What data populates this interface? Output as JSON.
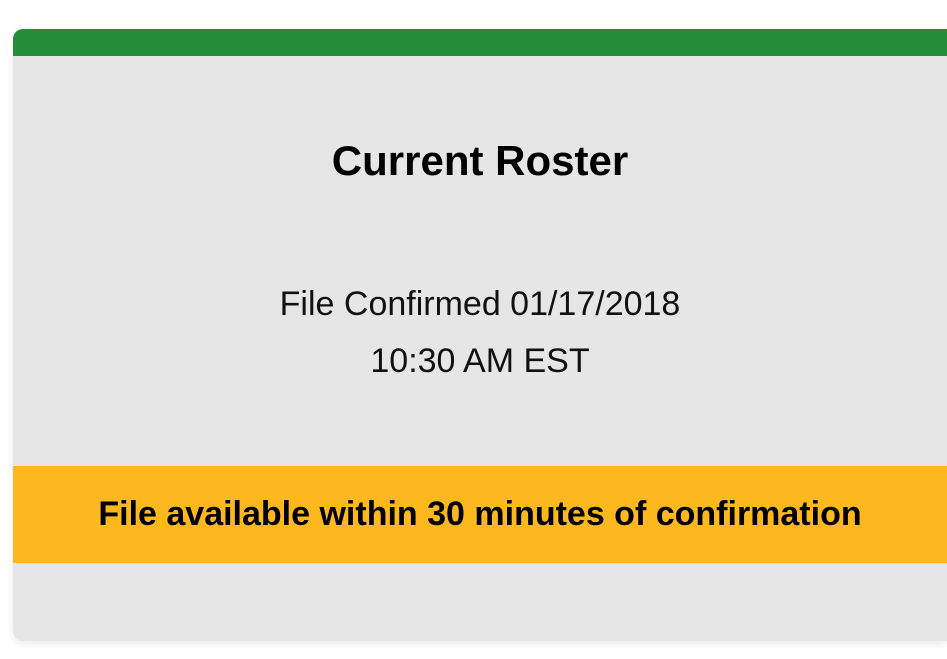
{
  "card": {
    "title": "Current Roster",
    "confirmation": {
      "line1": "File Confirmed 01/17/2018",
      "line2": "10:30 AM EST"
    },
    "notice": "File available within 30 minutes of confirmation"
  },
  "colors": {
    "status_bar": "#238e37",
    "notice_background": "#fdb81e",
    "card_background": "#e6e6e6"
  }
}
